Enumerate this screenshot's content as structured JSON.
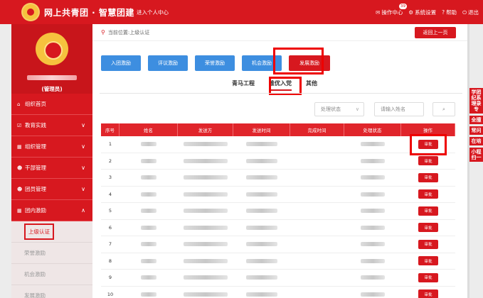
{
  "header": {
    "brand": "网上共青团 · 智慧团建",
    "personal_center": "进入个人中心",
    "nav": [
      {
        "label": "操作中心",
        "badge": "39",
        "icon": "mail-icon"
      },
      {
        "label": "系统设置",
        "icon": "gear-icon"
      },
      {
        "label": "帮助",
        "icon": "help-icon"
      },
      {
        "label": "退出",
        "icon": "power-icon"
      }
    ]
  },
  "sidebar": {
    "role": "(管理员)",
    "items": [
      {
        "label": "组织首页",
        "icon": "home-icon"
      },
      {
        "label": "教育实践",
        "icon": "check-icon",
        "chev": "∨"
      },
      {
        "label": "组织管理",
        "icon": "org-icon",
        "chev": "∨"
      },
      {
        "label": "干部管理",
        "icon": "users-icon",
        "chev": "∨"
      },
      {
        "label": "团员管理",
        "icon": "users-icon",
        "chev": "∨"
      },
      {
        "label": "团内激励",
        "icon": "org-icon",
        "chev": "∧"
      }
    ],
    "subitems": [
      "上级认证",
      "荣誉激励",
      "机会激励",
      "发展激励"
    ]
  },
  "location": "当前位置:上级认证",
  "back_label": "返回上一页",
  "type_buttons": [
    "入团激励",
    "评议激励",
    "荣誉激励",
    "机会激励",
    "发展激励"
  ],
  "tabs": [
    "青马工程",
    "推优入党",
    "其他"
  ],
  "filters": {
    "status_placeholder": "处理状态",
    "name_placeholder": "请输入姓名"
  },
  "table": {
    "headers": [
      "序号",
      "姓名",
      "发送方",
      "发送时间",
      "完成时间",
      "处理状态",
      "操作"
    ],
    "rows": [
      "1",
      "2",
      "3",
      "4",
      "5",
      "6",
      "7",
      "8",
      "9",
      "10"
    ],
    "action_label": "审批"
  },
  "right_float": [
    "学团纪系理录专",
    "全撞",
    "常问",
    "在培",
    "小程扫一"
  ]
}
